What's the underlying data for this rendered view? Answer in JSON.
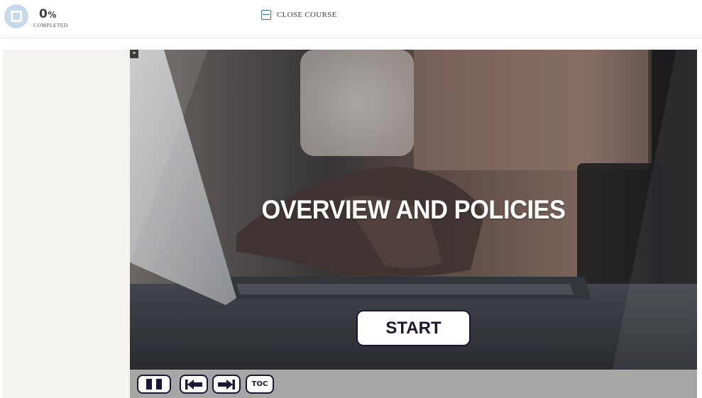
{
  "header": {
    "progress_value": "0",
    "progress_symbol": "%",
    "progress_caption": "COMPLETED",
    "close_label": "CLOSE COURSE"
  },
  "icons": {
    "progress": "progress-ring-icon",
    "close": "close-course-icon",
    "expand": "expand-chevrons-icon",
    "pause": "pause-icon",
    "previous": "previous-slide-icon",
    "next": "next-slide-icon"
  },
  "slide": {
    "title": "OVERVIEW AND POLICIES",
    "start_label": "START"
  },
  "controls": {
    "toc_label": "TOC"
  },
  "colors": {
    "accent_dark": "#1e1436",
    "progress_ring": "#c9d9ec",
    "close_icon": "#3f6ea8",
    "control_bar": "#a6a6a6",
    "sidebar": "#f4f3f0"
  }
}
